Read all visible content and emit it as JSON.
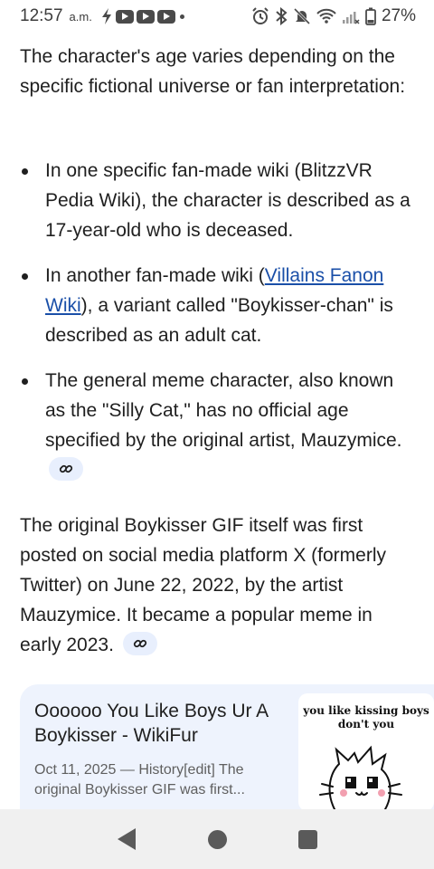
{
  "status_bar": {
    "time": "12:57",
    "ampm": "a.m.",
    "battery": "27%"
  },
  "content": {
    "intro": "The character's age varies depending on the specific fictional universe or fan interpretation:",
    "bullets": [
      {
        "text": "In one specific fan-made wiki (BlitzzVR Pedia Wiki), the character is described as a 17-year-old who is deceased."
      },
      {
        "before": "In another fan-made wiki (",
        "link": "Villains Fanon Wiki",
        "after": "), a variant called \"Boykisser-chan\" is described as an adult cat."
      },
      {
        "text": "The general meme character, also known as the \"Silly Cat,\" has no official age specified by the original artist, Mauzymice."
      }
    ],
    "paragraph2": "The original Boykisser GIF itself was first posted on social media platform X (formerly Twitter) on June 22, 2022, by the artist Mauzymice. It became a popular meme in early 2023."
  },
  "source_card": {
    "title": "Oooooo You Like Boys Ur A Boykisser - WikiFur",
    "snippet": "Oct 11, 2025 — History[edit] The original Boykisser GIF was first...",
    "thumbnail_caption": "you like kissing boys don't you"
  },
  "icons": {
    "link_chip": "link-icon",
    "nav_back": "back-icon",
    "nav_home": "home-icon",
    "nav_recents": "recents-icon"
  },
  "colors": {
    "link": "#1a4fa8",
    "chip_bg": "#e8effd",
    "card_bg": "#eef3fd",
    "nav_bg": "#f0f0f0"
  }
}
